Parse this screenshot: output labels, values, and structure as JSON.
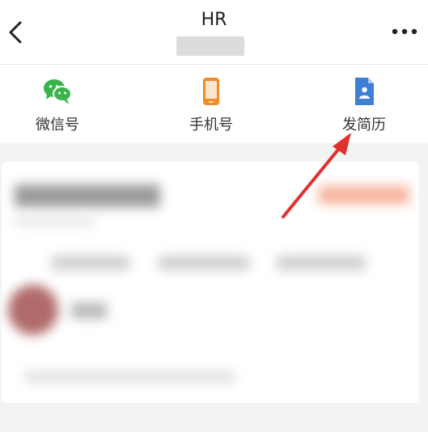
{
  "header": {
    "title": "HR",
    "back_icon": "chevron-left-icon",
    "more_icon": "more-horizontal-icon"
  },
  "actions": [
    {
      "label": "微信号",
      "icon": "wechat-icon",
      "color": "#3ab44a"
    },
    {
      "label": "手机号",
      "icon": "phone-icon",
      "color": "#f28a26"
    },
    {
      "label": "发简历",
      "icon": "resume-icon",
      "color": "#3f7fd6"
    }
  ],
  "annotation": {
    "icon": "red-arrow-icon",
    "color": "#e0312d"
  }
}
